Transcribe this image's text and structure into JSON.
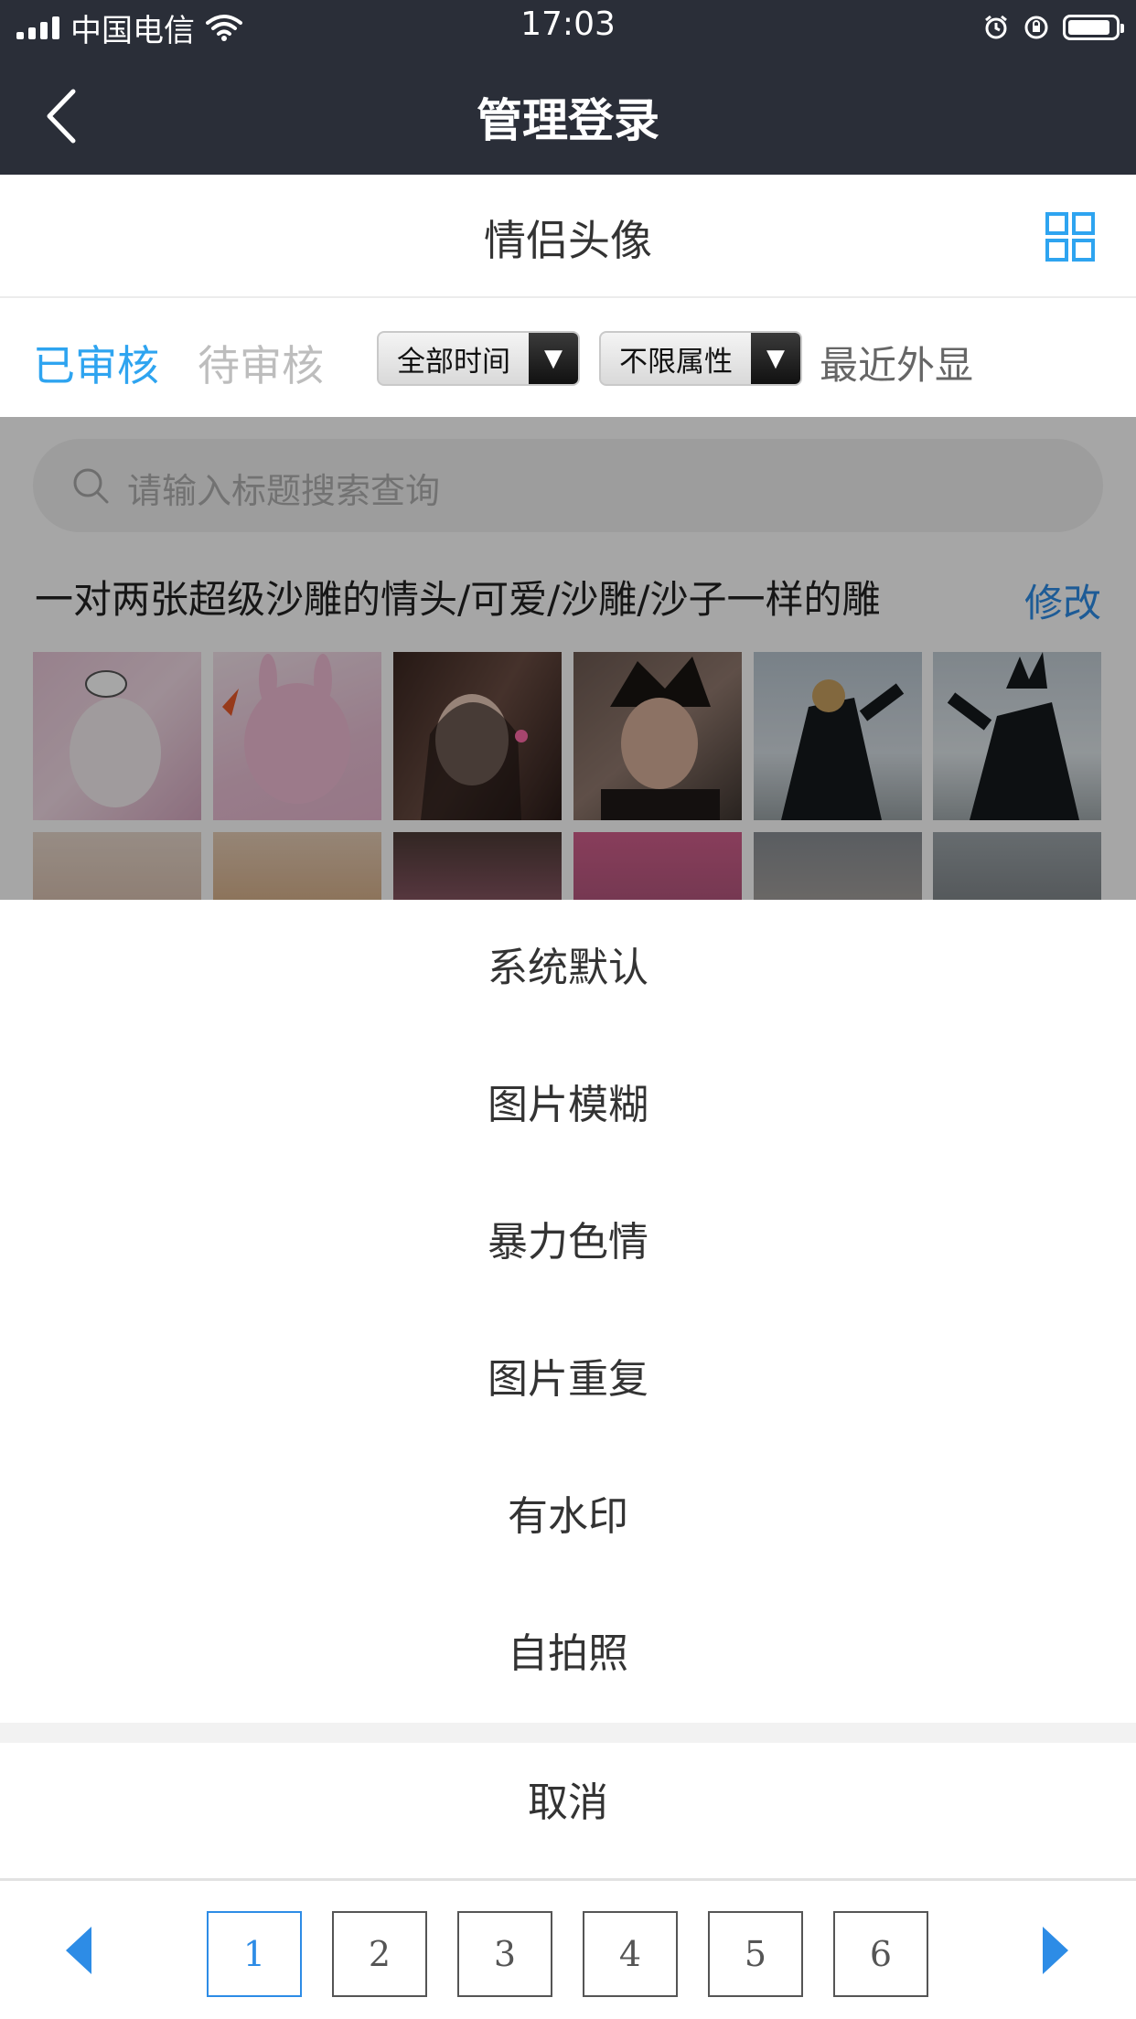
{
  "status_bar": {
    "carrier": "中国电信",
    "time": "17:03"
  },
  "nav": {
    "title": "管理登录"
  },
  "page": {
    "title": "情侣头像"
  },
  "filters": {
    "tab_active": "已审核",
    "tab_inactive": "待审核",
    "dropdown_time": "全部时间",
    "dropdown_attr": "不限属性",
    "recent": "最近外显"
  },
  "search": {
    "placeholder": "请输入标题搜索查询"
  },
  "post": {
    "title": "一对两张超级沙雕的情头/可爱/沙雕/沙子一样的雕",
    "edit_label": "修改"
  },
  "action_sheet": {
    "items": [
      "系统默认",
      "图片模糊",
      "暴力色情",
      "图片重复",
      "有水印",
      "自拍照"
    ],
    "cancel": "取消"
  },
  "pagination": {
    "pages": [
      "1",
      "2",
      "3",
      "4",
      "5",
      "6"
    ],
    "current": "1"
  },
  "colors": {
    "accent": "#2ea4f0",
    "link": "#2d8ce6",
    "nav_bg": "#2a2e38"
  },
  "icons": [
    "back-chevron-icon",
    "grid-view-icon",
    "search-icon",
    "wifi-icon",
    "alarm-icon",
    "rotation-lock-icon",
    "battery-icon",
    "prev-arrow-icon",
    "next-arrow-icon"
  ]
}
